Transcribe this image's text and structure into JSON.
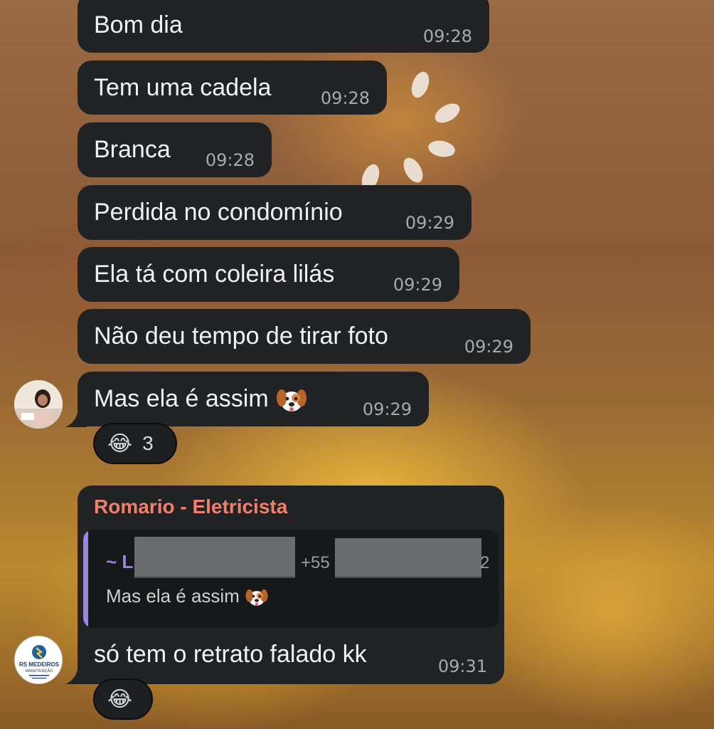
{
  "messages": [
    {
      "text": "Bom dia",
      "time": "09:28"
    },
    {
      "text": "Tem uma cadela",
      "time": "09:28"
    },
    {
      "text": "Branca",
      "time": "09:28"
    },
    {
      "text": "Perdida no condomínio",
      "time": "09:29"
    },
    {
      "text": "Ela tá com coleira lilás",
      "time": "09:29"
    },
    {
      "text": "Não deu tempo de tirar foto",
      "time": "09:29"
    },
    {
      "text": "Mas ela é assim",
      "emoji": "dog-face-icon",
      "time": "09:29",
      "reaction": {
        "emoji": "😂",
        "count": "3"
      }
    }
  ],
  "reply_message": {
    "sender": "Romario - Eletricista",
    "sender_color": "#f0806a",
    "quote": {
      "author_prefix": "~ L",
      "phone_prefix": "+55",
      "phone_suffix": "2",
      "text": "Mas ela é assim",
      "emoji": "dog-face-icon",
      "accent_color": "#9b84e6"
    },
    "text": "só tem o retrato falado kk",
    "time": "09:31",
    "reaction": {
      "emoji": "😂"
    }
  },
  "avatars": [
    {
      "name": "contact-avatar-photo"
    },
    {
      "name": "rs-medeiros-logo",
      "lines": [
        "RS MEDEIROS",
        "MANUTENÇÃO"
      ]
    }
  ],
  "colors": {
    "bubble": "#212224",
    "time": "#a9aaac",
    "text": "#f2f2f2"
  }
}
